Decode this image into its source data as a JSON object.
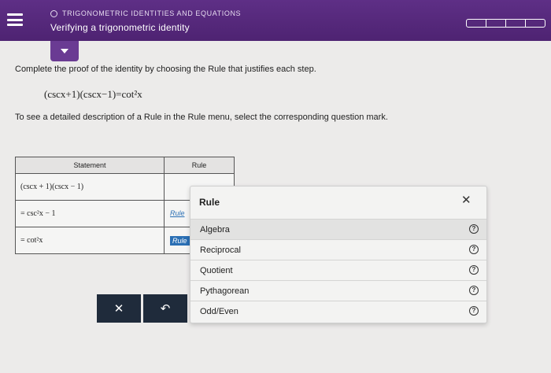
{
  "header": {
    "section": "TRIGONOMETRIC IDENTITIES AND EQUATIONS",
    "topic": "Verifying a trigonometric identity"
  },
  "instructions": {
    "line1": "Complete the proof of the identity by choosing the Rule that justifies each step.",
    "identity": "(cscx+1)(cscx−1)=cot²x",
    "line2": "To see a detailed description of a Rule in the Rule menu, select the corresponding question mark."
  },
  "table": {
    "headers": [
      "Statement",
      "Rule"
    ],
    "rows": [
      {
        "statement": "(cscx + 1)(cscx − 1)",
        "rule": ""
      },
      {
        "statement": "= csc²x − 1",
        "rule": "Rule"
      },
      {
        "statement": "= cot²x",
        "rule": "Rule"
      }
    ]
  },
  "buttons": {
    "clear": "✕",
    "undo": "↶"
  },
  "rule_menu": {
    "title": "Rule",
    "close": "✕",
    "help": "?",
    "items": [
      "Algebra",
      "Reciprocal",
      "Quotient",
      "Pythagorean",
      "Odd/Even"
    ]
  }
}
